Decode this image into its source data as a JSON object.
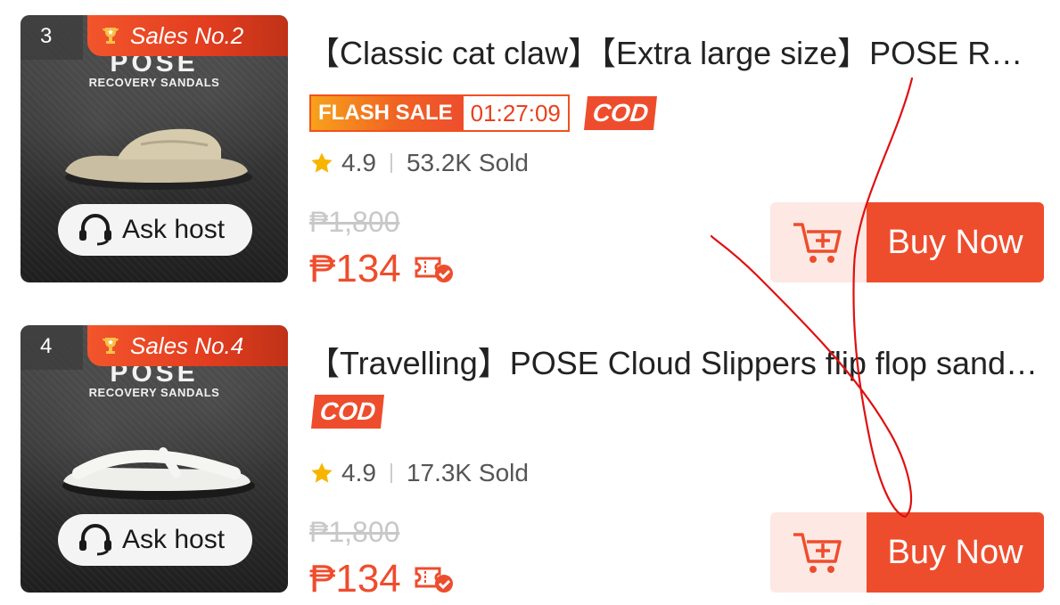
{
  "products": [
    {
      "rank": "3",
      "sales_badge": "Sales No.2",
      "thumb_brand": "POSE",
      "thumb_sub": "RECOVERY SANDALS",
      "ask_host": "Ask host",
      "title": "【Classic cat claw】【Extra large size】POSE Recovery Sandals",
      "flash_label": "FLASH SALE",
      "flash_timer": "01:27:09",
      "cod": "COD",
      "rating": "4.9",
      "sold": "53.2K Sold",
      "original_price": "₱1,800",
      "price": "₱134",
      "buy_label": "Buy Now",
      "sandal_color": "#c9bea1"
    },
    {
      "rank": "4",
      "sales_badge": "Sales No.4",
      "thumb_brand": "POSE",
      "thumb_sub": "RECOVERY SANDALS",
      "ask_host": "Ask host",
      "title": "【Travelling】POSE Cloud Slippers flip flop sandals",
      "cod": "COD",
      "rating": "4.9",
      "sold": "17.3K Sold",
      "original_price": "₱1,800",
      "price": "₱134",
      "buy_label": "Buy Now",
      "sandal_color": "#eeeeea"
    }
  ],
  "colors": {
    "accent": "#ee4d2d",
    "star": "#f7b500",
    "annotation_stroke": "#e01010"
  }
}
